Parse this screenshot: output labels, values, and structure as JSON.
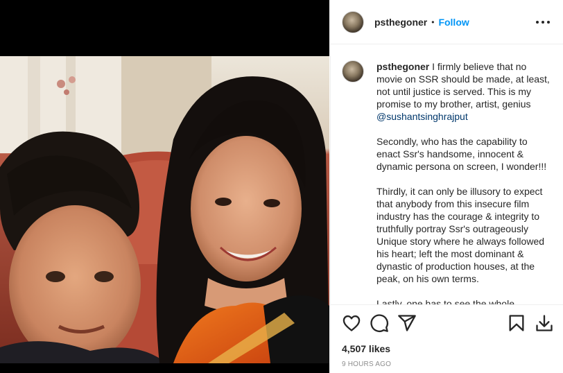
{
  "post": {
    "username": "psthegoner",
    "separator": "•",
    "follow_label": "Follow",
    "more_icon": "more-options-icon"
  },
  "caption": {
    "username": "psthegoner",
    "p1_a": "I firmly believe that no movie on SSR should be made, at least, not until justice is served. This is my promise to my brother, artist, genius",
    "p1_mention": "@sushantsinghrajput",
    "p2": "Secondly, who has the capability to enact Ssr's handsome, innocent & dynamic persona on screen, I wonder!!!",
    "p3": "Thirdly, it can only be illusory to expect that anybody from this insecure film industry has the courage & integrity to truthfully portray Ssr's outrageously Unique story where he always followed his heart; left the most dominant & dynastic of production houses, at the peak, on his own terms.",
    "p4": "Lastly, one has to see the whole"
  },
  "actions": {
    "icons": [
      "heart-icon",
      "comment-icon",
      "share-icon",
      "save-icon",
      "download-icon"
    ],
    "likes": "4,507 likes",
    "time": "9 HOURS AGO"
  },
  "colors": {
    "accent": "#0095f6",
    "text": "#262626",
    "muted": "#8e8e8e",
    "mention": "#00376b",
    "divider": "#efefef"
  }
}
